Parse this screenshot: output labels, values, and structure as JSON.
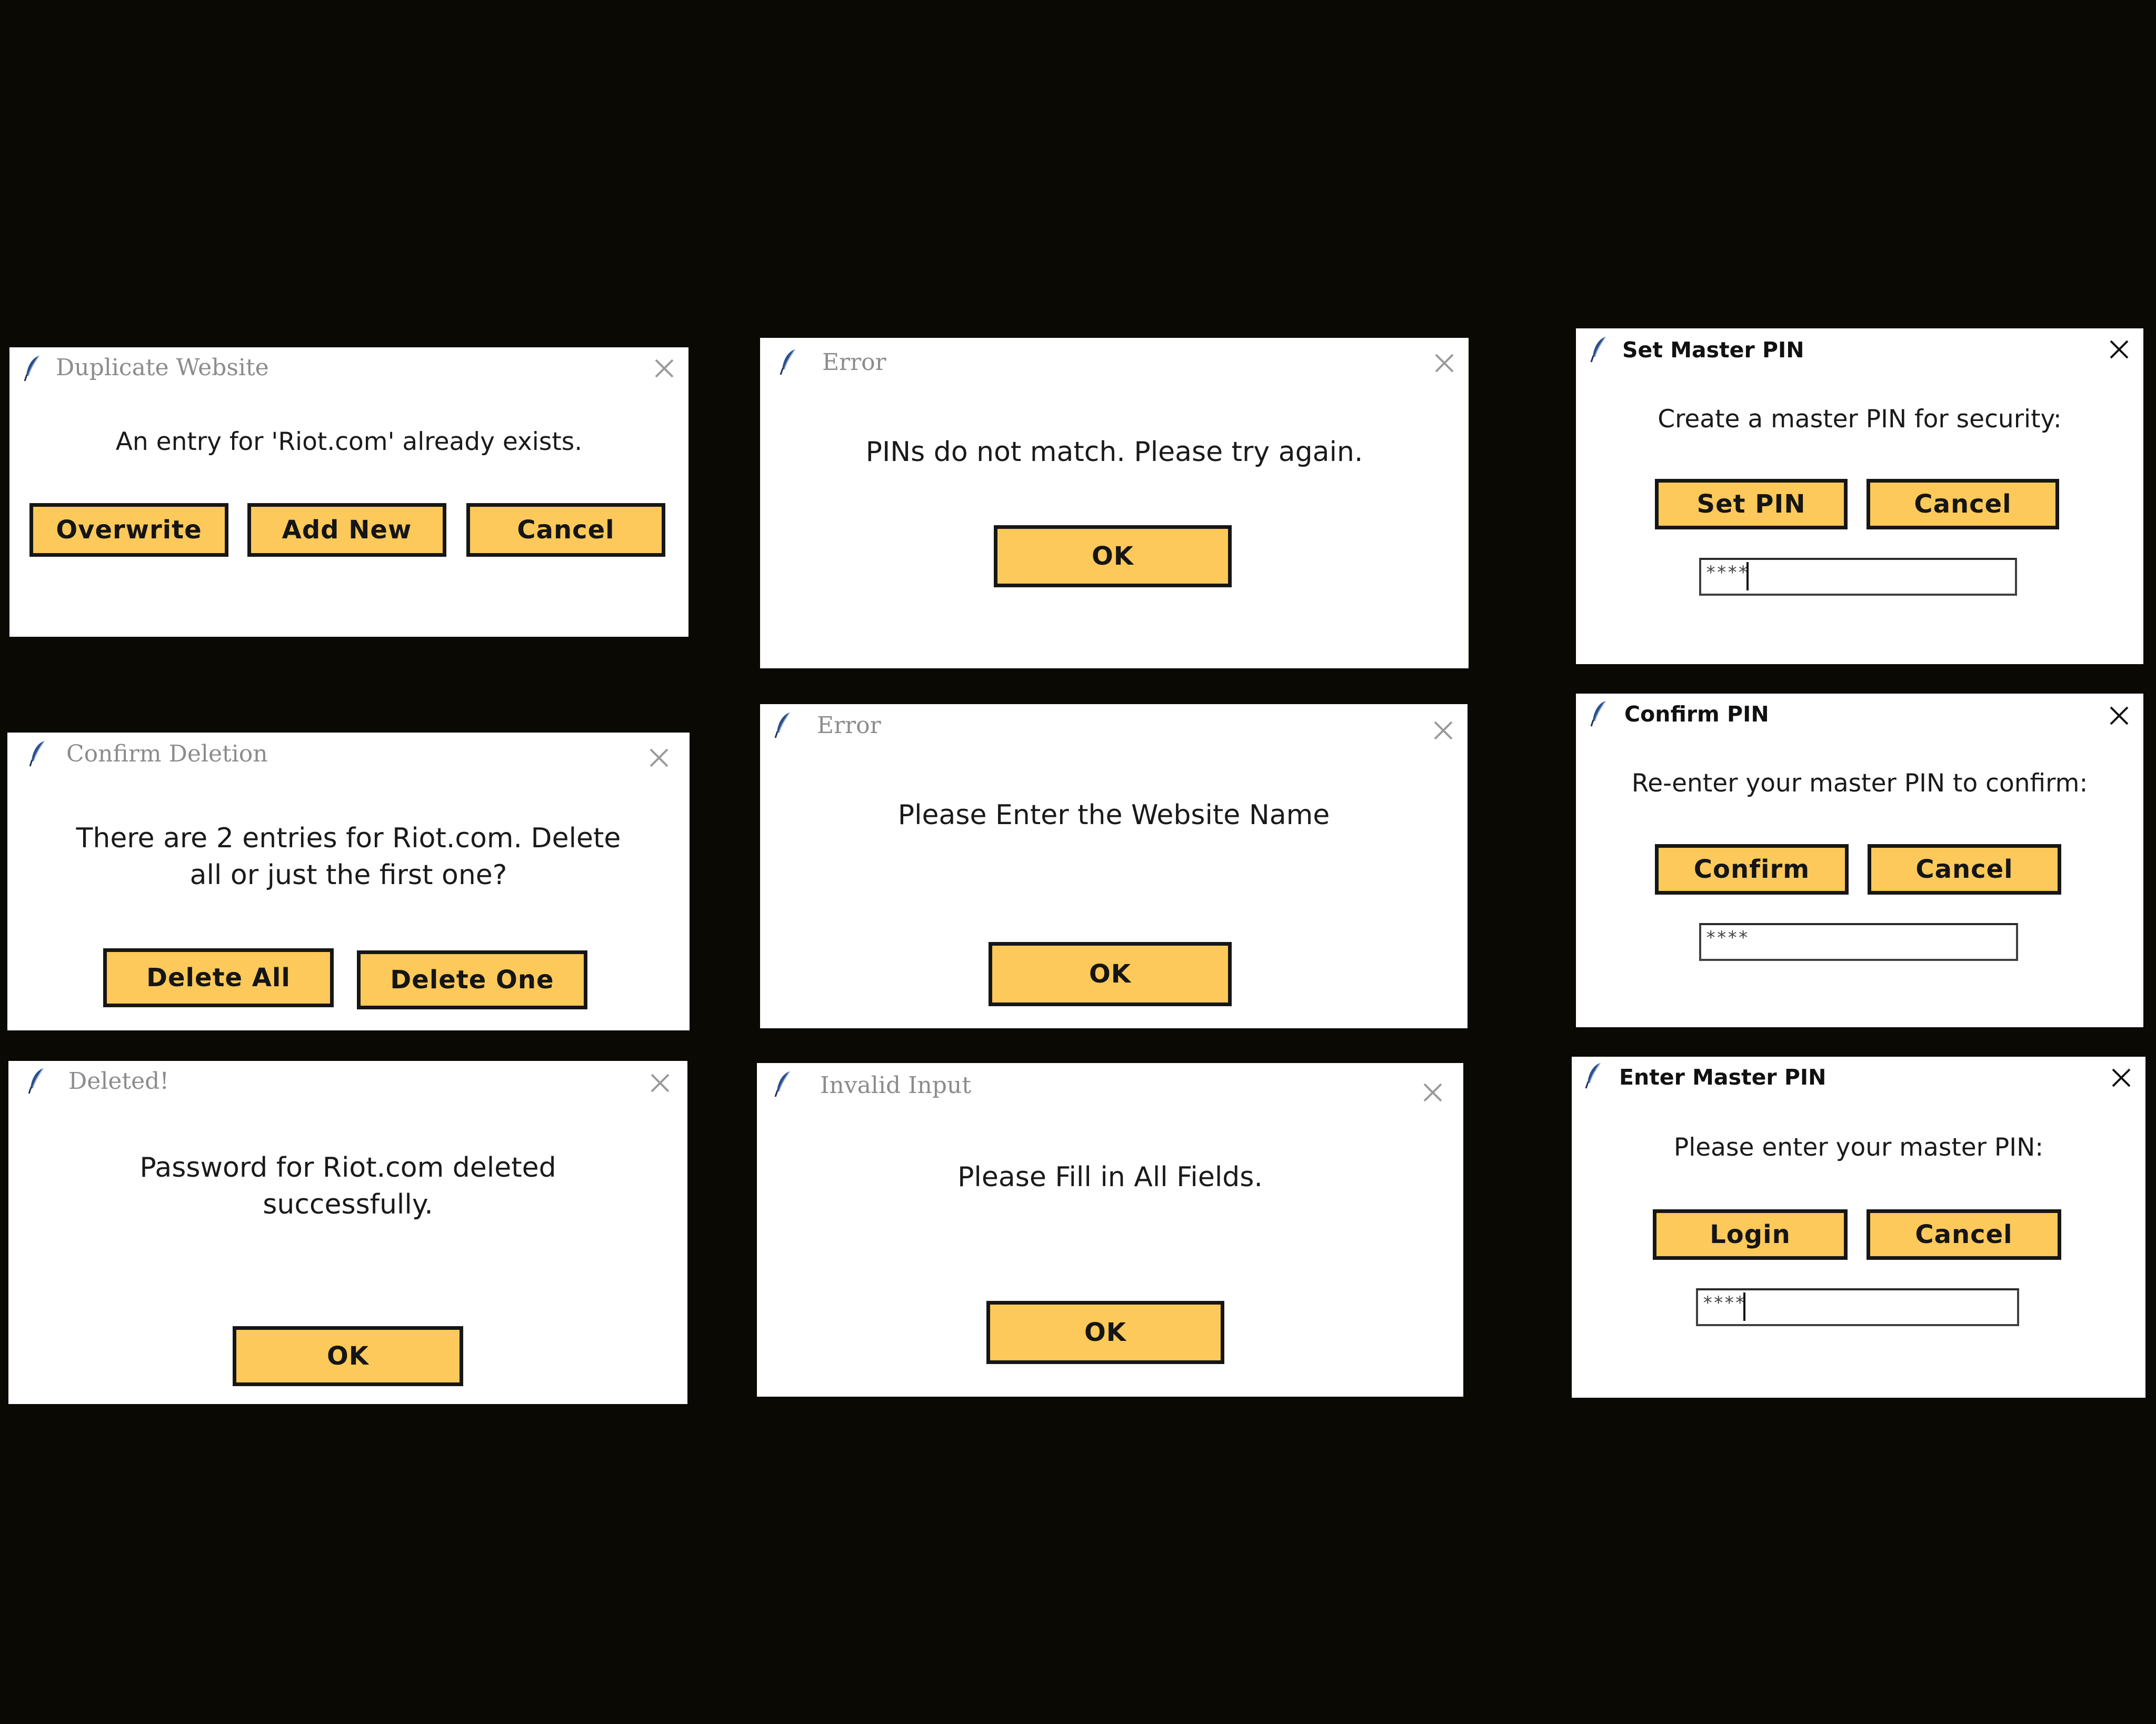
{
  "dialogs": {
    "duplicate": {
      "title": "Duplicate Website",
      "message": "An entry for 'Riot.com' already exists.",
      "buttons": [
        "Overwrite",
        "Add New",
        "Cancel"
      ]
    },
    "error_pins": {
      "title": "Error",
      "message": "PINs do not match. Please try again.",
      "ok": "OK"
    },
    "set_pin": {
      "title": "Set Master PIN",
      "message": "Create a master PIN for security:",
      "buttons": [
        "Set PIN",
        "Cancel"
      ],
      "pin_value": "****"
    },
    "confirm_deletion": {
      "title": "Confirm Deletion",
      "message_line1": "There are 2 entries for Riot.com. Delete",
      "message_line2": "all or just the first one?",
      "buttons": [
        "Delete All",
        "Delete One"
      ]
    },
    "error_website": {
      "title": "Error",
      "message": "Please Enter the Website Name",
      "ok": "OK"
    },
    "confirm_pin": {
      "title": "Confirm PIN",
      "message": "Re-enter your master PIN to confirm:",
      "buttons": [
        "Confirm",
        "Cancel"
      ],
      "pin_value": "****"
    },
    "deleted": {
      "title": "Deleted!",
      "message_line1": "Password for Riot.com deleted",
      "message_line2": "successfully.",
      "ok": "OK"
    },
    "invalid_input": {
      "title": "Invalid Input",
      "message": "Please Fill in All Fields.",
      "ok": "OK"
    },
    "enter_pin": {
      "title": "Enter Master PIN",
      "message": "Please enter your master PIN:",
      "buttons": [
        "Login",
        "Cancel"
      ],
      "pin_value": "****"
    }
  },
  "colors": {
    "background": "#0a0904",
    "button_fill": "#fcc95a",
    "button_border": "#161616",
    "inactive_title": "#8c8c8c",
    "active_title": "#111111"
  },
  "icons": {
    "title_icon": "feather-icon",
    "close_icon": "close-icon"
  }
}
